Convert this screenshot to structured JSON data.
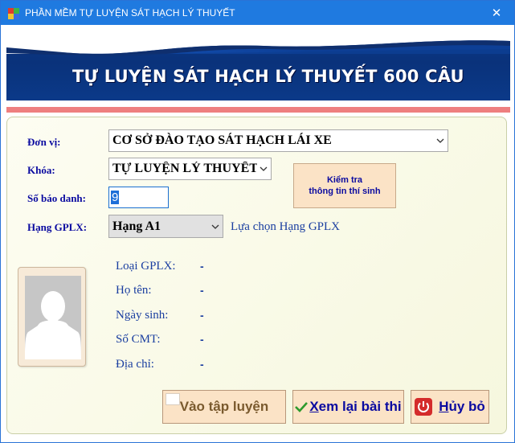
{
  "window": {
    "title": "PHẦN MỀM TỰ LUYỆN SÁT HẠCH LÝ THUYẾT",
    "close_glyph": "✕"
  },
  "banner": {
    "title": "TỰ LUYỆN SÁT HẠCH LÝ THUYẾT 600 CÂU"
  },
  "form": {
    "don_vi": {
      "label": "Đơn vị:",
      "value": "CƠ SỞ ĐÀO TẠO SÁT HẠCH LÁI XE"
    },
    "khoa": {
      "label": "Khóa:",
      "value": "TỰ LUYỆN LÝ THUYẾT"
    },
    "so_bao_danh": {
      "label": "Số báo danh:",
      "value": "9"
    },
    "hang_gplx": {
      "label": "Hạng GPLX:",
      "value": "Hạng A1",
      "hint": "Lựa chọn Hạng GPLX"
    },
    "check_button": {
      "line1": "Kiểm tra",
      "line2": "thông tin thí sinh"
    }
  },
  "candidate": {
    "fields": [
      {
        "label": "Loại GPLX:",
        "value": "-"
      },
      {
        "label": "Họ tên:",
        "value": "-"
      },
      {
        "label": "Ngày sinh:",
        "value": "-"
      },
      {
        "label": "Số CMT:",
        "value": "-"
      },
      {
        "label": "Địa chỉ:",
        "value": "-"
      }
    ]
  },
  "actions": {
    "train": "Vào tập luyện",
    "review_prefix": "X",
    "review_rest": "em lại bài thi",
    "cancel_prefix": "H",
    "cancel_rest": "ủy bỏ"
  },
  "colors": {
    "titlebar": "#1f7ae0",
    "label_blue": "#0a0aa0",
    "button_bg": "#fbe3c6",
    "accent_red_line": "#ee7f7f"
  },
  "icons": {
    "app": "app-icon",
    "close": "close-icon",
    "dropdown": "chevron-down-icon",
    "avatar": "avatar-placeholder-icon",
    "check": "checkmark-icon",
    "power": "power-icon"
  }
}
